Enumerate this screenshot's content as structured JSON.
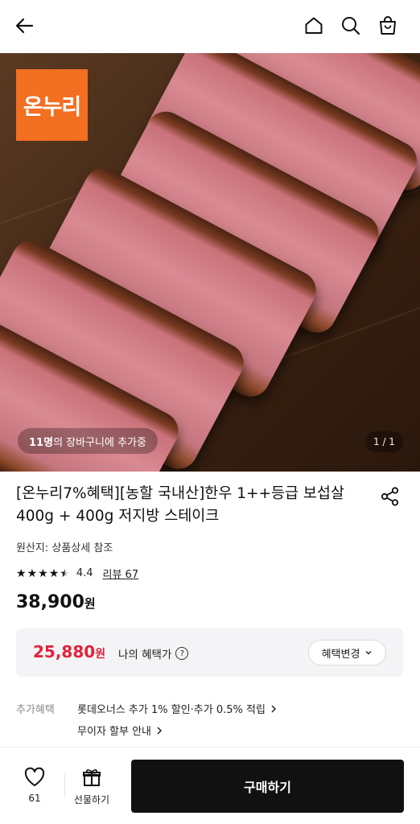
{
  "header": {
    "back_icon": "arrow-left-icon",
    "home_icon": "home-icon",
    "search_icon": "search-icon",
    "cart_icon": "shopping-bag-icon"
  },
  "hero": {
    "badge_text": "온누리",
    "badge_color": "#f36f21",
    "cart_count": "11명",
    "cart_text": "의 장바구니에 추가중",
    "pager": "1 / 1"
  },
  "product": {
    "title_line1": "[온누리7%혜택][농할 국내산]한우 1++등급 보섭살",
    "title_line2": "400g + 400g 저지방 스테이크",
    "origin": "원산지: 상품상세 참조",
    "rating": "4.4",
    "rating_stars": 4.5,
    "reviews": "리뷰 67",
    "price": "38,900",
    "price_unit": "원"
  },
  "benefit": {
    "price": "25,880",
    "price_unit": "원",
    "label": "나의 혜택가",
    "change_button": "혜택변경",
    "price_color": "#e0233a"
  },
  "extra": {
    "label": "추가혜택",
    "line1": "롯데오너스 추가 1% 할인·추가 0.5% 적립",
    "line2": "무이자 할부 안내"
  },
  "bottom": {
    "wish_count": "61",
    "gift_label": "선물하기",
    "buy_label": "구매하기"
  }
}
